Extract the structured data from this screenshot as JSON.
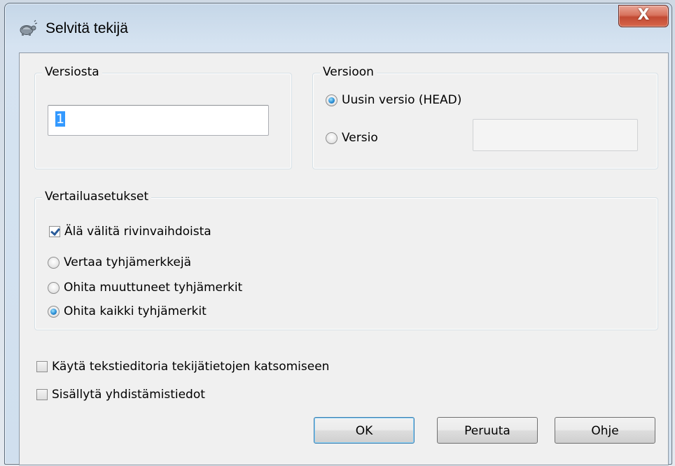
{
  "window": {
    "title": "Selvitä tekijä",
    "close_glyph": "X"
  },
  "background_app": {
    "row_text": "",
    "blurred_left": "",
    "blurred_right": ""
  },
  "from_revision": {
    "legend": "Versiosta",
    "value": "1"
  },
  "to_revision": {
    "legend": "Versioon",
    "options": [
      {
        "label": "Uusin versio (HEAD)",
        "selected": true
      },
      {
        "label": "Versio",
        "selected": false
      }
    ],
    "revision_value": ""
  },
  "diff_options": {
    "legend": "Vertailuasetukset",
    "ignore_eol": {
      "label": "Älä välitä rivinvaihdoista",
      "checked": true
    },
    "whitespace": [
      {
        "label": "Vertaa tyhjämerkkejä",
        "selected": false
      },
      {
        "label": "Ohita muuttuneet tyhjämerkit",
        "selected": false
      },
      {
        "label": "Ohita kaikki tyhjämerkit",
        "selected": true
      }
    ]
  },
  "extra": {
    "use_text_viewer": {
      "label": "Käytä tekstieditoria tekijätietojen katsomiseen",
      "checked": false
    },
    "include_merge": {
      "label": "Sisällytä yhdistämistiedot",
      "checked": false
    }
  },
  "buttons": {
    "ok": "OK",
    "cancel": "Peruuta",
    "help": "Ohje"
  },
  "icons": {
    "title": "tortoise-icon"
  },
  "colors": {
    "close_button": "#c24a33",
    "selection": "#3399ff",
    "default_button_border": "#3c7fb1"
  }
}
